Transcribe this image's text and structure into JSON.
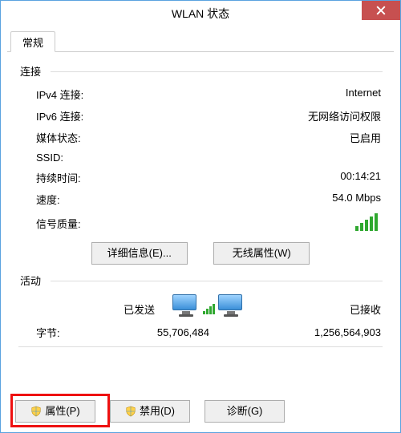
{
  "window": {
    "title": "WLAN 状态"
  },
  "tabs": {
    "general": "常规"
  },
  "connection": {
    "group_label": "连接",
    "ipv4_label": "IPv4 连接:",
    "ipv4_value": "Internet",
    "ipv6_label": "IPv6 连接:",
    "ipv6_value": "无网络访问权限",
    "media_label": "媒体状态:",
    "media_value": "已启用",
    "ssid_label": "SSID:",
    "ssid_value": "",
    "duration_label": "持续时间:",
    "duration_value": "00:14:21",
    "speed_label": "速度:",
    "speed_value": "54.0 Mbps",
    "signal_label": "信号质量:"
  },
  "buttons": {
    "details": "详细信息(E)...",
    "wireless_props": "无线属性(W)",
    "properties": "属性(P)",
    "disable": "禁用(D)",
    "diagnose": "诊断(G)"
  },
  "activity": {
    "group_label": "活动",
    "sent_label": "已发送",
    "recv_label": "已接收",
    "bytes_label": "字节:",
    "bytes_sent": "55,706,484",
    "bytes_recv": "1,256,564,903"
  }
}
